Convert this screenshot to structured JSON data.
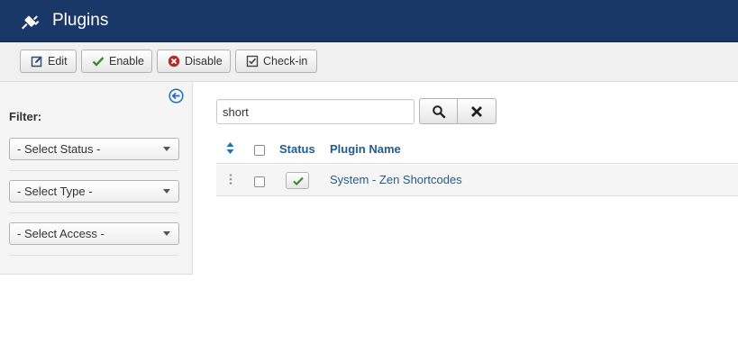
{
  "header": {
    "title": "Plugins",
    "icon": "plug-icon"
  },
  "toolbar": {
    "edit_label": "Edit",
    "enable_label": "Enable",
    "disable_label": "Disable",
    "checkin_label": "Check-in"
  },
  "sidebar": {
    "filter_label": "Filter:",
    "status_select": "- Select Status -",
    "type_select": "- Select Type -",
    "access_select": "- Select Access -"
  },
  "search": {
    "value": "short"
  },
  "table": {
    "columns": {
      "status": "Status",
      "name": "Plugin Name"
    },
    "rows": [
      {
        "name": "System - Zen Shortcodes",
        "enabled": true
      }
    ]
  },
  "colors": {
    "header_bg": "#1a3867",
    "link": "#1f5b94",
    "enabled_check": "#3a8a2e",
    "disable_icon": "#b52b27"
  }
}
